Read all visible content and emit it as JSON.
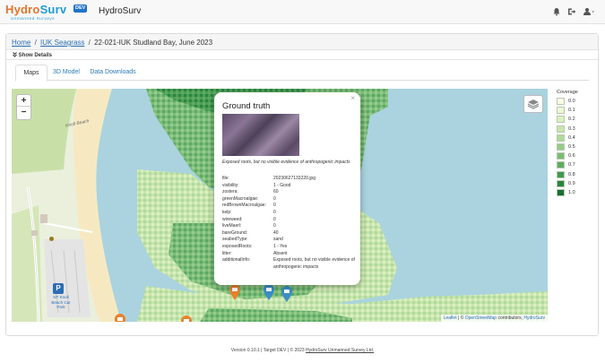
{
  "brand": {
    "logo_word_a": "Hydro",
    "logo_word_b": "Surv",
    "logo_badge": "DEV",
    "logo_tagline": "Unmanned Surveys",
    "app_title": "HydroSurv"
  },
  "nav_icons": [
    "bell-icon",
    "sign-out-icon",
    "user-menu-icon"
  ],
  "breadcrumb": {
    "home": "Home",
    "parent": "IUK Seagrass",
    "current": "22-021-IUK Studland Bay, June 2023",
    "separator": "/"
  },
  "show_details": "Show Details",
  "tabs": [
    {
      "label": "Maps",
      "active": true
    },
    {
      "label": "3D Model",
      "active": false
    },
    {
      "label": "Data Downloads",
      "active": false
    }
  ],
  "map": {
    "zoom_in": "+",
    "zoom_out": "−",
    "labels": {
      "knoll_beach": "Knoll Beach",
      "car_park_p": "P",
      "car_park_text": "NT Knoll Beach Car Park"
    },
    "attribution": {
      "leaflet": "Leaflet",
      "osm_prefix": "©",
      "osm": "OpenStreetMap",
      "contrib": "contributors,",
      "hydrosurv": "HydroSurv"
    }
  },
  "popup": {
    "close": "×",
    "title": "Ground truth",
    "caption": "Exposed roots, but no visible evidence of anthropogenic impacts",
    "rows": [
      {
        "key": "file:",
        "value": "20230627133220.jpg"
      },
      {
        "key": "visibility:",
        "value": "1 - Good"
      },
      {
        "key": "zostera:",
        "value": "60"
      },
      {
        "key": "greenMacroalgae:",
        "value": "0"
      },
      {
        "key": "redBrownMacroalgae:",
        "value": "0"
      },
      {
        "key": "kelp:",
        "value": "0"
      },
      {
        "key": "wireweed:",
        "value": "0"
      },
      {
        "key": "liveMaerl:",
        "value": "0"
      },
      {
        "key": "bareGround:",
        "value": "40"
      },
      {
        "key": "seabedType:",
        "value": "sand"
      },
      {
        "key": "exposedRoots:",
        "value": "1 - Yes"
      },
      {
        "key": "litter:",
        "value": "Absent"
      },
      {
        "key": "additionalInfo:",
        "value": "Exposed roots, but no visible evidence of anthropogenic impacts"
      }
    ]
  },
  "legend": {
    "title": "Coverage",
    "items": [
      {
        "label": "0.0",
        "color": "#fdfde6"
      },
      {
        "label": "0.1",
        "color": "#eef6d2"
      },
      {
        "label": "0.2",
        "color": "#dcefc0"
      },
      {
        "label": "0.3",
        "color": "#c7e5ae"
      },
      {
        "label": "0.4",
        "color": "#b0da9b"
      },
      {
        "label": "0.5",
        "color": "#96cc88"
      },
      {
        "label": "0.6",
        "color": "#7abd75"
      },
      {
        "label": "0.7",
        "color": "#5eab61"
      },
      {
        "label": "0.8",
        "color": "#44984f"
      },
      {
        "label": "0.9",
        "color": "#2b8440"
      },
      {
        "label": "1.0",
        "color": "#176f32"
      }
    ]
  },
  "footer": {
    "version": "Version 0.10.1",
    "sep": "|",
    "target": "Target DEV",
    "copyright": "© 2023",
    "company": "HydroSurv Unmanned Survey Ltd."
  },
  "colors": {
    "brand_orange": "#e8742a",
    "brand_blue": "#1f9bd1",
    "link": "#2a6db5",
    "water": "#aad3df",
    "marker_orange": "#e8822e",
    "marker_blue": "#3a8fc7"
  }
}
